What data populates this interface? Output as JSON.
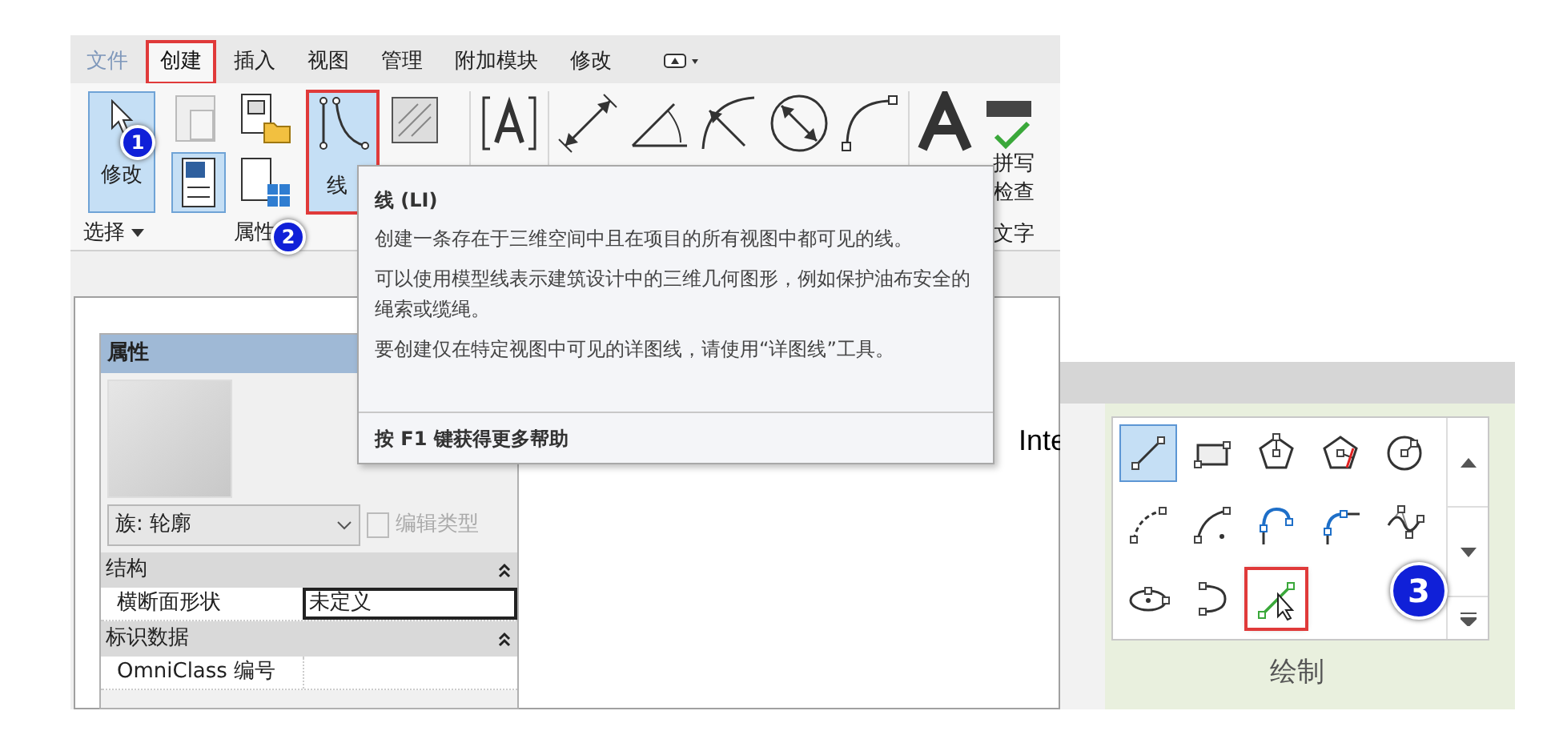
{
  "ribbon": {
    "tabs": [
      {
        "label": "文件",
        "selected": false,
        "highlighted": false
      },
      {
        "label": "创建",
        "selected": true,
        "highlighted": true
      },
      {
        "label": "插入",
        "selected": false,
        "highlighted": false
      },
      {
        "label": "视图",
        "selected": false,
        "highlighted": false
      },
      {
        "label": "管理",
        "selected": false,
        "highlighted": false
      },
      {
        "label": "附加模块",
        "selected": false,
        "highlighted": false
      },
      {
        "label": "修改",
        "selected": false,
        "highlighted": false
      }
    ],
    "modify_button": {
      "label": "修改",
      "selected": true
    },
    "line_button": {
      "label": "线",
      "selected": true,
      "highlighted": true
    },
    "spell_button": {
      "lines": [
        "拼写",
        "检查"
      ]
    },
    "groups": [
      {
        "label": "选择",
        "dropdown": true
      },
      {
        "label": "属性",
        "dropdown": false
      }
    ],
    "text_group_label": "文字"
  },
  "callouts": [
    {
      "label": "1"
    },
    {
      "label": "2"
    },
    {
      "label": "3"
    }
  ],
  "tooltip": {
    "title": "线 (LI)",
    "paragraphs": [
      "创建一条存在于三维空间中且在项目的所有视图中都可见的线。",
      "可以使用模型线表示建筑设计中的三维几何图形，例如保护油布安全的绳索或缆绳。",
      "要创建仅在特定视图中可见的详图线，请使用“详图线”工具。"
    ],
    "footer": "按 F1 键获得更多帮助"
  },
  "properties": {
    "title": "属性",
    "type_selector": "族: 轮廓",
    "edit_type": "编辑类型",
    "groups": [
      {
        "name": "结构",
        "expanded": true,
        "rows": [
          {
            "label": "横断面形状",
            "value": "未定义",
            "selected": true
          }
        ]
      },
      {
        "name": "标识数据",
        "expanded": true,
        "rows": [
          {
            "label": "OmniClass 编号",
            "selected": false
          }
        ]
      }
    ]
  },
  "draw_panel": {
    "side_text": "Inte",
    "label": "绘制",
    "tools": [
      {
        "kind": "line",
        "selected": true,
        "highlighted": false
      },
      {
        "kind": "rectangle",
        "selected": false,
        "highlighted": false
      },
      {
        "kind": "inscribed-polygon",
        "selected": false,
        "highlighted": false
      },
      {
        "kind": "circumscribed-polygon",
        "selected": false,
        "highlighted": false
      },
      {
        "kind": "circle",
        "selected": false,
        "highlighted": false
      },
      {
        "kind": "arc-three-point",
        "selected": false,
        "highlighted": false
      },
      {
        "kind": "arc-center",
        "selected": false,
        "highlighted": false
      },
      {
        "kind": "tangent-arc",
        "selected": false,
        "highlighted": false
      },
      {
        "kind": "fillet-arc",
        "selected": false,
        "highlighted": false
      },
      {
        "kind": "spline",
        "selected": false,
        "highlighted": false
      },
      {
        "kind": "ellipse",
        "selected": false,
        "highlighted": false
      },
      {
        "kind": "partial-ellipse",
        "selected": false,
        "highlighted": false
      },
      {
        "kind": "pick-lines",
        "selected": false,
        "highlighted": true
      }
    ]
  }
}
